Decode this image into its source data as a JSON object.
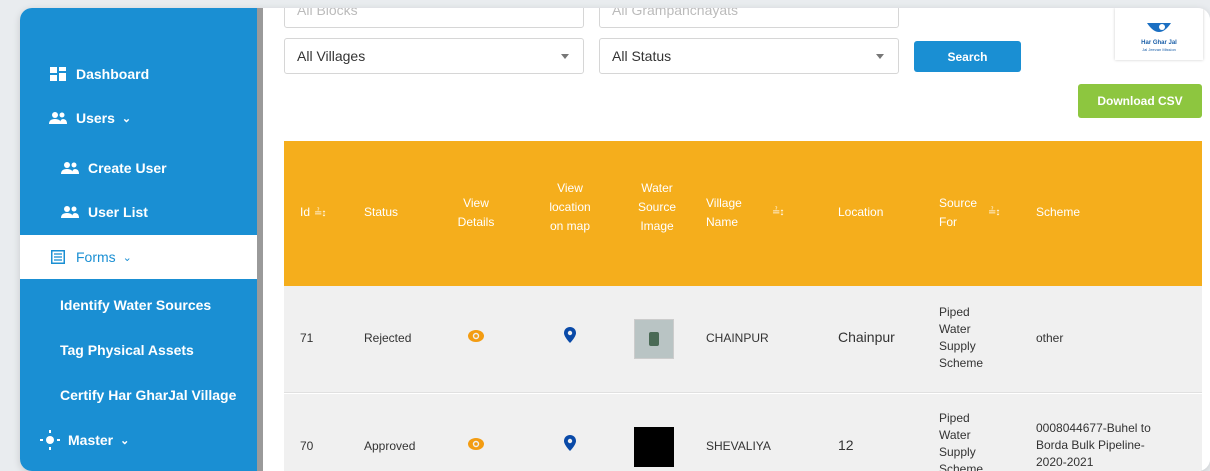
{
  "sidebar": {
    "items": [
      {
        "label": "Dashboard",
        "icon": "dashboard-icon"
      },
      {
        "label": "Users",
        "icon": "users-icon"
      },
      {
        "label": "Create User",
        "icon": "users-icon"
      },
      {
        "label": "User List",
        "icon": "users-icon"
      },
      {
        "label": "Forms",
        "icon": "forms-icon"
      },
      {
        "label": "Identify Water Sources"
      },
      {
        "label": "Tag Physical Assets"
      },
      {
        "label": "Certify Har GharJal Village"
      },
      {
        "label": "Master",
        "icon": "master-icon"
      }
    ]
  },
  "filters": {
    "top_left": "All Blocks",
    "top_right": "All Grampanchayats",
    "villages": "All Villages",
    "status": "All Status",
    "search_label": "Search"
  },
  "logo": {
    "line1": "Har Ghar Jal",
    "line2": "Jal Jeevan Mission"
  },
  "download_label": "Download CSV",
  "table": {
    "headers": {
      "id": "Id",
      "status": "Status",
      "view_details": "View Details",
      "view_location": "View location on map",
      "water_source_image": "Water Source Image",
      "village_name": "Village Name",
      "location": "Location",
      "source_for": "Source For",
      "scheme": "Scheme"
    },
    "rows": [
      {
        "id": "71",
        "status": "Rejected",
        "village": "CHAINPUR",
        "location": "Chainpur",
        "source_for": "Piped Water Supply Scheme",
        "scheme": "other"
      },
      {
        "id": "70",
        "status": "Approved",
        "village": "SHEVALIYA",
        "location": "12",
        "source_for": "Piped Water Supply Scheme",
        "scheme": "0008044677-Buhel to Borda Bulk Pipeline-2020-2021"
      }
    ]
  },
  "colors": {
    "sidebar": "#1a8fd3",
    "header": "#f5ae1c",
    "search": "#1a8fd3",
    "download": "#8dc63f",
    "eye": "#f39c12",
    "pin": "#0a4aa8"
  }
}
